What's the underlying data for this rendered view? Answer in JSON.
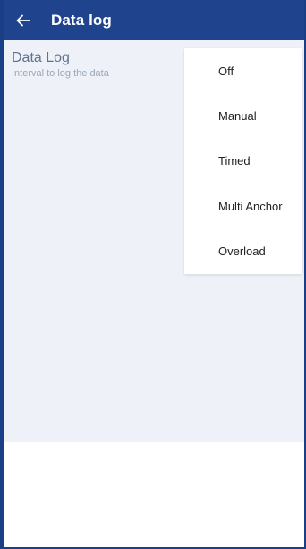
{
  "colors": {
    "appbar": "#1f448d",
    "frame_border": "#1b3f86",
    "content_bg": "#eef2f8",
    "title_text": "#5f7391",
    "subtitle_text": "#9ba7b8"
  },
  "appbar": {
    "back_icon": "arrow-left-icon",
    "title": "Data log"
  },
  "setting": {
    "title": "Data Log",
    "subtitle": "Interval to log the data"
  },
  "dropdown": {
    "options": [
      "Off",
      "Manual",
      "Timed",
      "Multi Anchor",
      "Overload"
    ]
  }
}
